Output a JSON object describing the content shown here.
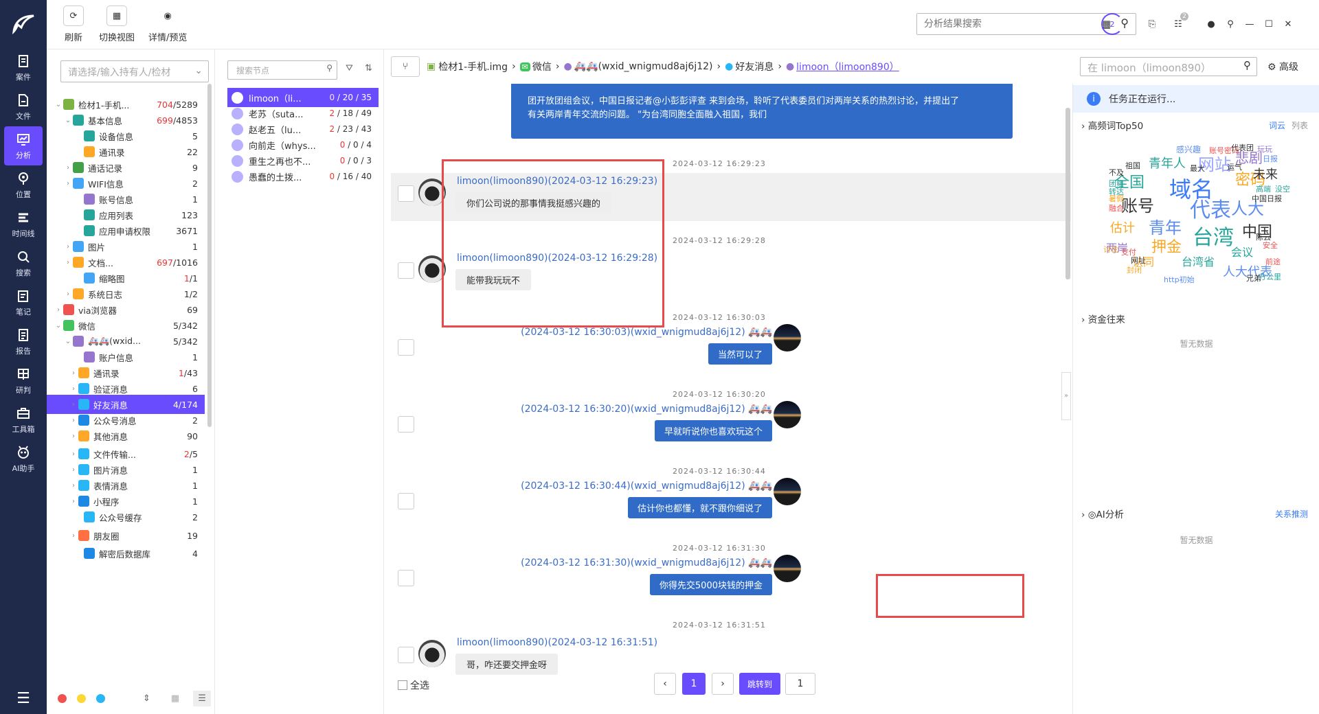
{
  "nav": {
    "items": [
      {
        "label": "案件",
        "icon": "case-icon"
      },
      {
        "label": "文件",
        "icon": "file-icon"
      },
      {
        "label": "分析",
        "icon": "analysis-icon",
        "active": true
      },
      {
        "label": "位置",
        "icon": "location-icon"
      },
      {
        "label": "时间线",
        "icon": "timeline-icon"
      },
      {
        "label": "搜索",
        "icon": "search-icon"
      },
      {
        "label": "笔记",
        "icon": "note-icon"
      },
      {
        "label": "报告",
        "icon": "report-icon"
      },
      {
        "label": "研判",
        "icon": "judge-icon"
      },
      {
        "label": "工具箱",
        "icon": "toolbox-icon"
      },
      {
        "label": "AI助手",
        "icon": "ai-icon"
      }
    ]
  },
  "toolbar": {
    "refresh": "刷新",
    "switch_view": "切换视图",
    "detail_preview": "详情/预览",
    "search_placeholder": "分析结果搜索",
    "task_badge": "2",
    "notif_badge": "2"
  },
  "tree": {
    "owner_placeholder": "请选择/输入持有人/检材",
    "rows": [
      {
        "label": "检材1-手机...",
        "red": "704",
        "count": "/5289",
        "icon_color": "#7cb342"
      },
      {
        "label": "基本信息",
        "red": "699",
        "count": "/4853",
        "icon_color": "#26a69a"
      },
      {
        "label": "设备信息",
        "red": "",
        "count": "5",
        "icon_color": "#26a69a"
      },
      {
        "label": "通讯录",
        "red": "",
        "count": "22",
        "icon_color": "#ffa726"
      },
      {
        "label": "通话记录",
        "red": "",
        "count": "9",
        "icon_color": "#43a047"
      },
      {
        "label": "WIFI信息",
        "red": "",
        "count": "2",
        "icon_color": "#42a5f5"
      },
      {
        "label": "账号信息",
        "red": "",
        "count": "1",
        "icon_color": "#9575cd"
      },
      {
        "label": "应用列表",
        "red": "",
        "count": "123",
        "icon_color": "#26a69a"
      },
      {
        "label": "应用申请权限",
        "red": "",
        "count": "3671",
        "icon_color": "#26a69a"
      },
      {
        "label": "图片",
        "red": "",
        "count": "1",
        "icon_color": "#42a5f5"
      },
      {
        "label": "文档...",
        "red": "697",
        "count": "/1016",
        "icon_color": "#ffa726"
      },
      {
        "label": "缩略图",
        "red": "1",
        "count": "/1",
        "icon_color": "#42a5f5"
      },
      {
        "label": "系统日志",
        "red": "",
        "count": "1/2",
        "icon_color": "#ffa726"
      },
      {
        "label": "via浏览器",
        "red": "",
        "count": "69",
        "icon_color": "#ef5350"
      },
      {
        "label": "微信",
        "red": "",
        "count": "5/342",
        "icon_color": "#43c35e"
      },
      {
        "label": "🚑🚑(wxid...",
        "red": "",
        "count": "5/342",
        "icon_color": "#9575cd"
      },
      {
        "label": "账户信息",
        "red": "",
        "count": "1",
        "icon_color": "#9575cd"
      },
      {
        "label": "通讯录",
        "red": "1",
        "count": "/43",
        "icon_color": "#ffa726"
      },
      {
        "label": "验证消息",
        "red": "",
        "count": "6",
        "icon_color": "#29b6f6"
      },
      {
        "label": "好友消息",
        "red": "4",
        "count": "/174",
        "icon_color": "#29b6f6"
      },
      {
        "label": "公众号消息",
        "red": "",
        "count": "2",
        "icon_color": "#1e88e5"
      },
      {
        "label": "其他消息",
        "red": "",
        "count": "90",
        "icon_color": "#ffa726"
      },
      {
        "label": "文件传输...",
        "red": "2",
        "count": "/5",
        "icon_color": "#29b6f6"
      },
      {
        "label": "图片消息",
        "red": "",
        "count": "1",
        "icon_color": "#29b6f6"
      },
      {
        "label": "表情消息",
        "red": "",
        "count": "1",
        "icon_color": "#29b6f6"
      },
      {
        "label": "小程序",
        "red": "",
        "count": "1",
        "icon_color": "#1e88e5"
      },
      {
        "label": "公众号缓存",
        "red": "",
        "count": "2",
        "icon_color": "#29b6f6"
      },
      {
        "label": "朋友圈",
        "red": "",
        "count": "19",
        "icon_color": "#ff7043"
      },
      {
        "label": "解密后数据库",
        "red": "",
        "count": "4",
        "icon_color": "#1e88e5"
      }
    ]
  },
  "contacts": {
    "search_placeholder": "搜索节点",
    "items": [
      {
        "name": "limoon（li...",
        "red": "0",
        "count": " / 20 / 35"
      },
      {
        "name": "老苏（suta...",
        "red": "2",
        "count": " / 18 / 49"
      },
      {
        "name": "赵老五（lu...",
        "red": "2",
        "count": " / 23 / 43"
      },
      {
        "name": "向前走（whys...",
        "red": "0",
        "count": " / 0 / 4"
      },
      {
        "name": "重生之再也不...",
        "red": "0",
        "count": " / 0 / 3"
      },
      {
        "name": "愚蠢的土拨...",
        "red": "0",
        "count": " / 16 / 40"
      }
    ]
  },
  "breadcrumb": {
    "device": "检材1-手机.img",
    "app": "微信",
    "account": "🚑🚑(wxid_wnigmud8aj6j12)",
    "category": "好友消息",
    "contact": "limoon（limoon890）",
    "search_placeholder": "在 limoon（limoon890）",
    "advanced": "高级"
  },
  "chat": {
    "top_text": [
      "团开放团组会议，中国日报记者@小彭彭评查 来到会场，聆听了代表委员们对两岸关系的热烈讨论，并提出了",
      "有关两岸青年交流的问题。 \"为台湾同胞全面融入祖国，我们"
    ],
    "messages": [
      {
        "side": "left",
        "time": "2024-03-12 16:29:23",
        "name": "limoon(limoon890)(2024-03-12 16:29:23)",
        "text": "你们公司说的那事情我挺感兴趣的"
      },
      {
        "side": "left",
        "time": "2024-03-12 16:29:28",
        "name": "limoon(limoon890)(2024-03-12 16:29:28)",
        "text": "能带我玩玩不"
      },
      {
        "side": "right",
        "time": "2024-03-12 16:30:03",
        "name": "(2024-03-12 16:30:03)(wxid_wnigmud8aj6j12) 🚑🚑",
        "text": "当然可以了"
      },
      {
        "side": "right",
        "time": "2024-03-12 16:30:20",
        "name": "(2024-03-12 16:30:20)(wxid_wnigmud8aj6j12) 🚑🚑",
        "text": "早就听说你也喜欢玩这个"
      },
      {
        "side": "right",
        "time": "2024-03-12 16:30:44",
        "name": "(2024-03-12 16:30:44)(wxid_wnigmud8aj6j12) 🚑🚑",
        "text": "估计你也都懂，就不跟你细说了"
      },
      {
        "side": "right",
        "time": "2024-03-12 16:31:30",
        "name": "(2024-03-12 16:31:30)(wxid_wnigmud8aj6j12) 🚑🚑",
        "text": "你得先交5000块钱的押金"
      },
      {
        "side": "left",
        "time": "2024-03-12 16:31:51",
        "name": "limoon(limoon890)(2024-03-12 16:31:51)",
        "text": "哥，咋还要交押金呀"
      }
    ],
    "select_all": "全选",
    "pager": {
      "prev": "‹",
      "current": "1",
      "next": "›",
      "jump": "跳转到",
      "jump_value": "1"
    }
  },
  "right": {
    "task": "任务正在运行...",
    "hot_words_title": "高频词Top50",
    "word_cloud_tab": "词云",
    "list_tab": "列表",
    "funds_title": "资金往来",
    "funds_empty": "暂无数据",
    "ai_title": "AI分析",
    "ai_link": "关系推测",
    "ai_empty": "暂无数据",
    "words": [
      {
        "t": "域名",
        "c": "#3a7bf7"
      },
      {
        "t": "网站",
        "c": "#9aa7ff"
      },
      {
        "t": "代表",
        "c": "#5b8def"
      },
      {
        "t": "人大",
        "c": "#5b8def"
      },
      {
        "t": "账号",
        "c": "#333"
      },
      {
        "t": "全国",
        "c": "#26a69a"
      },
      {
        "t": "密码",
        "c": "#f9a825"
      },
      {
        "t": "青年",
        "c": "#5b8def"
      },
      {
        "t": "台湾",
        "c": "#26a69a"
      },
      {
        "t": "中国",
        "c": "#333"
      },
      {
        "t": "押金",
        "c": "#f9a825"
      },
      {
        "t": "估计",
        "c": "#f9a825"
      },
      {
        "t": "两岸",
        "c": "#9575cd"
      },
      {
        "t": "认同",
        "c": "#f9a825"
      },
      {
        "t": "台湾省",
        "c": "#26a69a"
      },
      {
        "t": "人大代表",
        "c": "#5b8def"
      },
      {
        "t": "会议",
        "c": "#26a69a"
      },
      {
        "t": "悲剧",
        "c": "#9575cd"
      },
      {
        "t": "未来",
        "c": "#333"
      },
      {
        "t": "青年人",
        "c": "#26a69a"
      },
      {
        "t": "感兴趣",
        "c": "#5b8def"
      },
      {
        "t": "账号密码",
        "c": "#ef5350"
      },
      {
        "t": "代表团",
        "c": "#333"
      },
      {
        "t": "日报",
        "c": "#5b8def"
      },
      {
        "t": "玩玩",
        "c": "#9575cd"
      },
      {
        "t": "中国日报",
        "c": "#333"
      },
      {
        "t": "兄弟",
        "c": "#333"
      },
      {
        "t": "方公里",
        "c": "#26a69a"
      },
      {
        "t": "http初始",
        "c": "#5b8def"
      },
      {
        "t": "网址",
        "c": "#333"
      },
      {
        "t": "支付",
        "c": "#ef5350"
      },
      {
        "t": "封闭",
        "c": "#f9a825"
      },
      {
        "t": "讨论",
        "c": "#f9a825"
      },
      {
        "t": "前途",
        "c": "#ef5350"
      },
      {
        "t": "安全",
        "c": "#ef5350"
      },
      {
        "t": "陈云",
        "c": "#333"
      },
      {
        "t": "高端",
        "c": "#26a69a"
      },
      {
        "t": "没空",
        "c": "#26a69a"
      },
      {
        "t": "祖国",
        "c": "#333"
      },
      {
        "t": "不及",
        "c": "#333"
      },
      {
        "t": "团组",
        "c": "#26a69a"
      },
      {
        "t": "转达",
        "c": "#26a69a"
      },
      {
        "t": "暑假",
        "c": "#f9a825"
      },
      {
        "t": "融合",
        "c": "#ef5350"
      },
      {
        "t": "运气",
        "c": "#333"
      },
      {
        "t": "最大",
        "c": "#333"
      }
    ]
  }
}
